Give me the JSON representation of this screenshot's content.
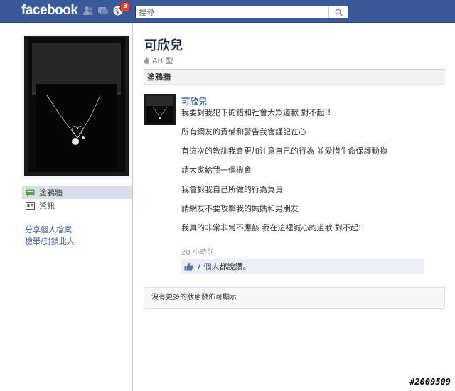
{
  "topbar": {
    "logo": "facebook",
    "notification_count": "3",
    "search_placeholder": "搜尋"
  },
  "profile": {
    "name": "可欣兒",
    "blood_type": "AB 型"
  },
  "nav": {
    "items": [
      {
        "label": "塗鴉牆",
        "icon": "wall-icon",
        "active": true
      },
      {
        "label": "資訊",
        "icon": "info-icon",
        "active": false
      }
    ]
  },
  "side_links": [
    "分享個人檔案",
    "檢舉/封鎖此人"
  ],
  "wall": {
    "header": "塗鴉牆"
  },
  "post": {
    "author": "可欣兒",
    "lines": [
      "我要對我犯下的錯和社會大眾道歉 對不起!!",
      "所有網友的責備和警告我會謹記在心",
      "有這次的教訓我會更加注意自己的行為 並愛惜生命保護動物",
      "請大家給我一個機會",
      "我會對我自己所做的行為負責",
      "請網友不要攻擊我的媽媽和男朋友",
      "我真的非常非常不應該 我在這裡誠心的道歉 對不起!!"
    ],
    "time": "20 小時前",
    "likes_link": "7 個人",
    "likes_text": "都說讚。"
  },
  "no_more": "沒有更多的狀態發佈可顯示",
  "watermark": "#2009509",
  "colors": {
    "brand": "#3b5998",
    "badge": "#f03d25"
  }
}
